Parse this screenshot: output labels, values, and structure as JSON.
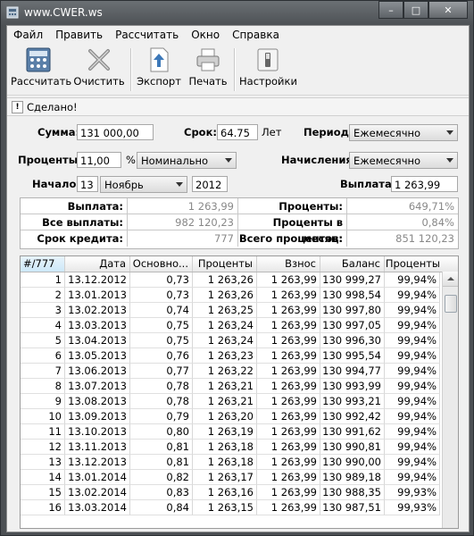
{
  "window": {
    "title": "www.CWER.ws"
  },
  "menu": [
    "Файл",
    "Править",
    "Рассчитать",
    "Окно",
    "Справка"
  ],
  "toolbar": {
    "calc": "Рассчитать",
    "clear": "Очистить",
    "export": "Экспорт",
    "print": "Печать",
    "settings": "Настройки"
  },
  "status": {
    "icon": "!",
    "text": "Сделано!"
  },
  "form": {
    "sum_label": "Сумма:",
    "sum_value": "131 000,00",
    "term_label": "Срок:",
    "term_value": "64.75",
    "term_unit": "Лет",
    "period_label": "Период:",
    "period_value": "Ежемесячно",
    "rate_label": "Проценты:",
    "rate_value": "11,00",
    "rate_unit": "%",
    "rate_type": "Номинально",
    "accrual_label": "Начисления:",
    "accrual_value": "Ежемесячно",
    "start_label": "Начало:",
    "start_day": "13",
    "start_month": "Ноябрь",
    "start_year": "2012",
    "payment_label": "Выплата:",
    "payment_value": "1 263,99"
  },
  "summary": {
    "payment_label": "Выплата:",
    "payment_value": "1 263,99",
    "interest_label": "Проценты:",
    "interest_value": "649,71%",
    "all_label": "Все выплаты:",
    "all_value": "982 120,23",
    "monthly_label": "Проценты в месяц:",
    "monthly_value": "0,84%",
    "duration_label": "Срок кредита:",
    "duration_value": "777",
    "total_label": "Всего процентов:",
    "total_value": "851 120,23"
  },
  "table": {
    "headers": [
      "#/777",
      "Дата",
      "Основно...",
      "Проценты",
      "Взнос",
      "Баланс",
      "Проценты"
    ],
    "rows": [
      [
        "1",
        "13.12.2012",
        "0,73",
        "1 263,26",
        "1 263,99",
        "130 999,27",
        "99,94%"
      ],
      [
        "2",
        "13.01.2013",
        "0,73",
        "1 263,26",
        "1 263,99",
        "130 998,54",
        "99,94%"
      ],
      [
        "3",
        "13.02.2013",
        "0,74",
        "1 263,25",
        "1 263,99",
        "130 997,80",
        "99,94%"
      ],
      [
        "4",
        "13.03.2013",
        "0,75",
        "1 263,24",
        "1 263,99",
        "130 997,05",
        "99,94%"
      ],
      [
        "5",
        "13.04.2013",
        "0,75",
        "1 263,24",
        "1 263,99",
        "130 996,30",
        "99,94%"
      ],
      [
        "6",
        "13.05.2013",
        "0,76",
        "1 263,23",
        "1 263,99",
        "130 995,54",
        "99,94%"
      ],
      [
        "7",
        "13.06.2013",
        "0,77",
        "1 263,22",
        "1 263,99",
        "130 994,77",
        "99,94%"
      ],
      [
        "8",
        "13.07.2013",
        "0,78",
        "1 263,21",
        "1 263,99",
        "130 993,99",
        "99,94%"
      ],
      [
        "9",
        "13.08.2013",
        "0,78",
        "1 263,21",
        "1 263,99",
        "130 993,21",
        "99,94%"
      ],
      [
        "10",
        "13.09.2013",
        "0,79",
        "1 263,20",
        "1 263,99",
        "130 992,42",
        "99,94%"
      ],
      [
        "11",
        "13.10.2013",
        "0,80",
        "1 263,19",
        "1 263,99",
        "130 991,62",
        "99,94%"
      ],
      [
        "12",
        "13.11.2013",
        "0,81",
        "1 263,18",
        "1 263,99",
        "130 990,81",
        "99,94%"
      ],
      [
        "13",
        "13.12.2013",
        "0,81",
        "1 263,18",
        "1 263,99",
        "130 990,00",
        "99,94%"
      ],
      [
        "14",
        "13.01.2014",
        "0,82",
        "1 263,17",
        "1 263,99",
        "130 989,18",
        "99,94%"
      ],
      [
        "15",
        "13.02.2014",
        "0,83",
        "1 263,16",
        "1 263,99",
        "130 988,35",
        "99,93%"
      ],
      [
        "16",
        "13.03.2014",
        "0,84",
        "1 263,15",
        "1 263,99",
        "130 987,51",
        "99,93%"
      ]
    ]
  }
}
